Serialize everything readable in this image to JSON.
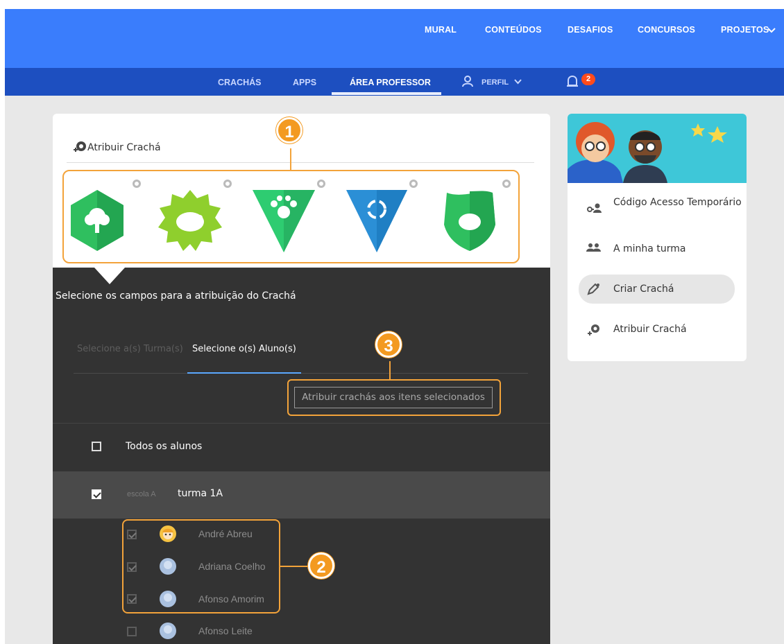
{
  "topnav": {
    "items": [
      "MURAL",
      "CONTEÚDOS",
      "DESAFIOS",
      "CONCURSOS",
      "PROJETOS"
    ]
  },
  "subnav": {
    "items": [
      "CRACHÁS",
      "APPS",
      "ÁREA PROFESSOR",
      "PERFIL"
    ],
    "notifications": "2"
  },
  "card": {
    "title": "Atribuir Crachá"
  },
  "panel": {
    "heading": "Selecione os campos para a atribuição do Crachá",
    "tab_classes": "Selecione a(s) Turma(s)",
    "tab_students": "Selecione o(s) Aluno(s)",
    "assign_button": "Atribuir crachás aos itens selecionados",
    "all_students": "Todos os alunos",
    "school": "escola A",
    "class": "turma 1A",
    "students": [
      "André Abreu",
      "Adriana Coelho",
      "Afonso Amorim",
      "Afonso Leite"
    ]
  },
  "callouts": [
    "1",
    "2",
    "3"
  ],
  "sidebar": {
    "items": [
      "Código Acesso Temporário",
      "A minha turma",
      "Criar Crachá",
      "Atribuir Crachá"
    ]
  },
  "colors": {
    "topbar": "#3a7dfc",
    "subbar": "#1d4fc0",
    "accent": "#f39a21",
    "panel": "#333333"
  }
}
